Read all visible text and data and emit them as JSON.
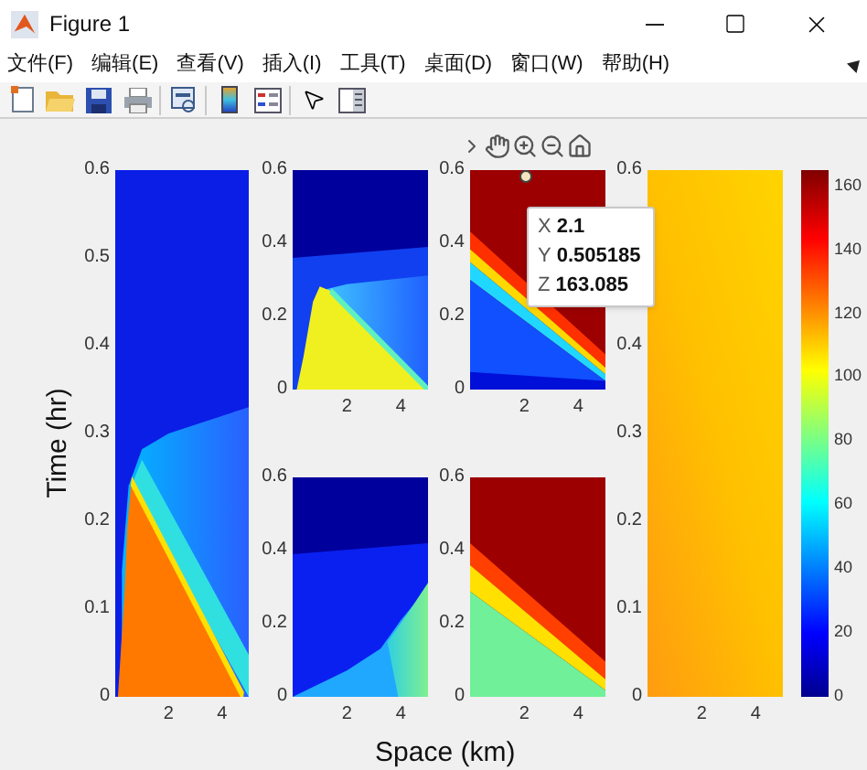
{
  "window": {
    "title": "Figure 1"
  },
  "menu": [
    "文件(F)",
    "编辑(E)",
    "查看(V)",
    "插入(I)",
    "工具(T)",
    "桌面(D)",
    "窗口(W)",
    "帮助(H)"
  ],
  "figure": {
    "ylabel": "Time (hr)",
    "xlabel": "Space (km)",
    "axes": [
      {
        "kind": "front",
        "yticks": [
          "0.6",
          "0.5",
          "0.4",
          "0.3",
          "0.2",
          "0.1",
          "0"
        ],
        "xticks": [
          "2",
          "4"
        ]
      },
      {
        "kind": "wedge",
        "yticks": [
          "0.6",
          "0.4",
          "0.2",
          "0"
        ],
        "xticks": [
          "2",
          "4"
        ]
      },
      {
        "kind": "ramp",
        "yticks": [
          "0.6",
          "0.4",
          "0.2",
          "0"
        ],
        "xticks": [
          "2",
          "4"
        ]
      },
      {
        "kind": "hot",
        "yticks": [
          "0.6",
          "0.4",
          "0.2",
          "0"
        ],
        "xticks": [
          "2",
          "4"
        ]
      },
      {
        "kind": "band",
        "yticks": [
          "0.6",
          "0.4",
          "0.2",
          "0"
        ],
        "xticks": [
          "2",
          "4"
        ]
      },
      {
        "kind": "flat",
        "yticks": [
          "0.6",
          "0.4",
          "0.3",
          "0.2",
          "0.1",
          "0"
        ],
        "xticks": [
          "2",
          "4"
        ]
      }
    ],
    "colorbar": {
      "ticks": [
        "160",
        "140",
        "120",
        "100",
        "80",
        "60",
        "40",
        "20",
        "0"
      ]
    },
    "datatip": {
      "rows": [
        {
          "name": "X",
          "value": "2.1"
        },
        {
          "name": "Y",
          "value": "0.505185"
        },
        {
          "name": "Z",
          "value": "163.085"
        }
      ]
    }
  }
}
